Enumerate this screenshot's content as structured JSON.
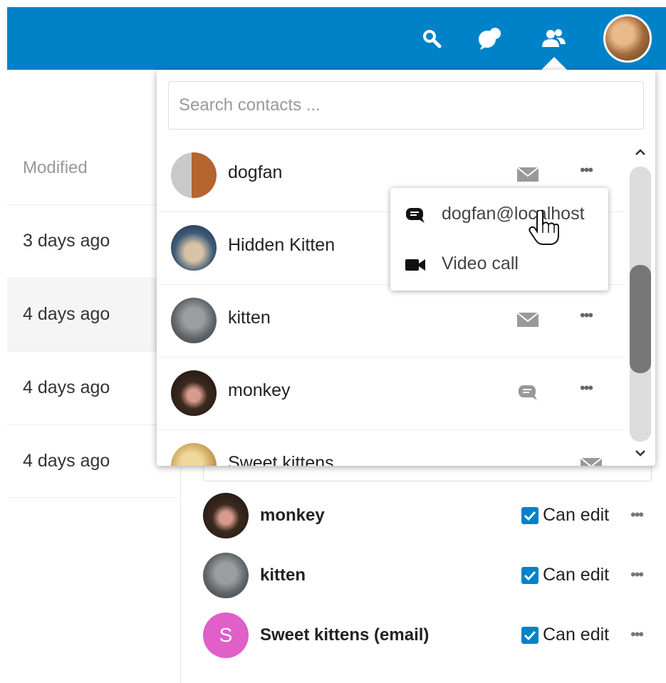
{
  "colors": {
    "brand": "#0082c9"
  },
  "header": {
    "icons": [
      "search-icon",
      "talk-icon",
      "contacts-icon"
    ],
    "user_avatar": "user-avatar"
  },
  "file_list": {
    "column_modified": "Modified",
    "rows": [
      {
        "modified": "3 days ago"
      },
      {
        "modified": "4 days ago",
        "highlighted": true
      },
      {
        "modified": "4 days ago"
      },
      {
        "modified": "4 days ago"
      }
    ]
  },
  "contacts_menu": {
    "search_placeholder": "Search contacts ...",
    "contacts": [
      {
        "name": "dogfan",
        "action_icon": "mail-icon"
      },
      {
        "name": "Hidden Kitten",
        "action_icon": ""
      },
      {
        "name": "kitten",
        "action_icon": "mail-icon"
      },
      {
        "name": "monkey",
        "action_icon": "talk-icon"
      },
      {
        "name": "Sweet kittens",
        "action_icon": "mail-icon"
      }
    ],
    "more_label": "•••",
    "action_menu": [
      {
        "icon": "talk-icon",
        "label": "dogfan@localhost"
      },
      {
        "icon": "video-icon",
        "label": "Video call"
      }
    ]
  },
  "sharing": {
    "shares": [
      {
        "name": "monkey",
        "permission": "Can edit",
        "checked": true
      },
      {
        "name": "kitten",
        "permission": "Can edit",
        "checked": true
      },
      {
        "name": "Sweet kittens (email)",
        "permission": "Can edit",
        "checked": true,
        "initial": "S"
      }
    ],
    "more_label": "•••"
  }
}
